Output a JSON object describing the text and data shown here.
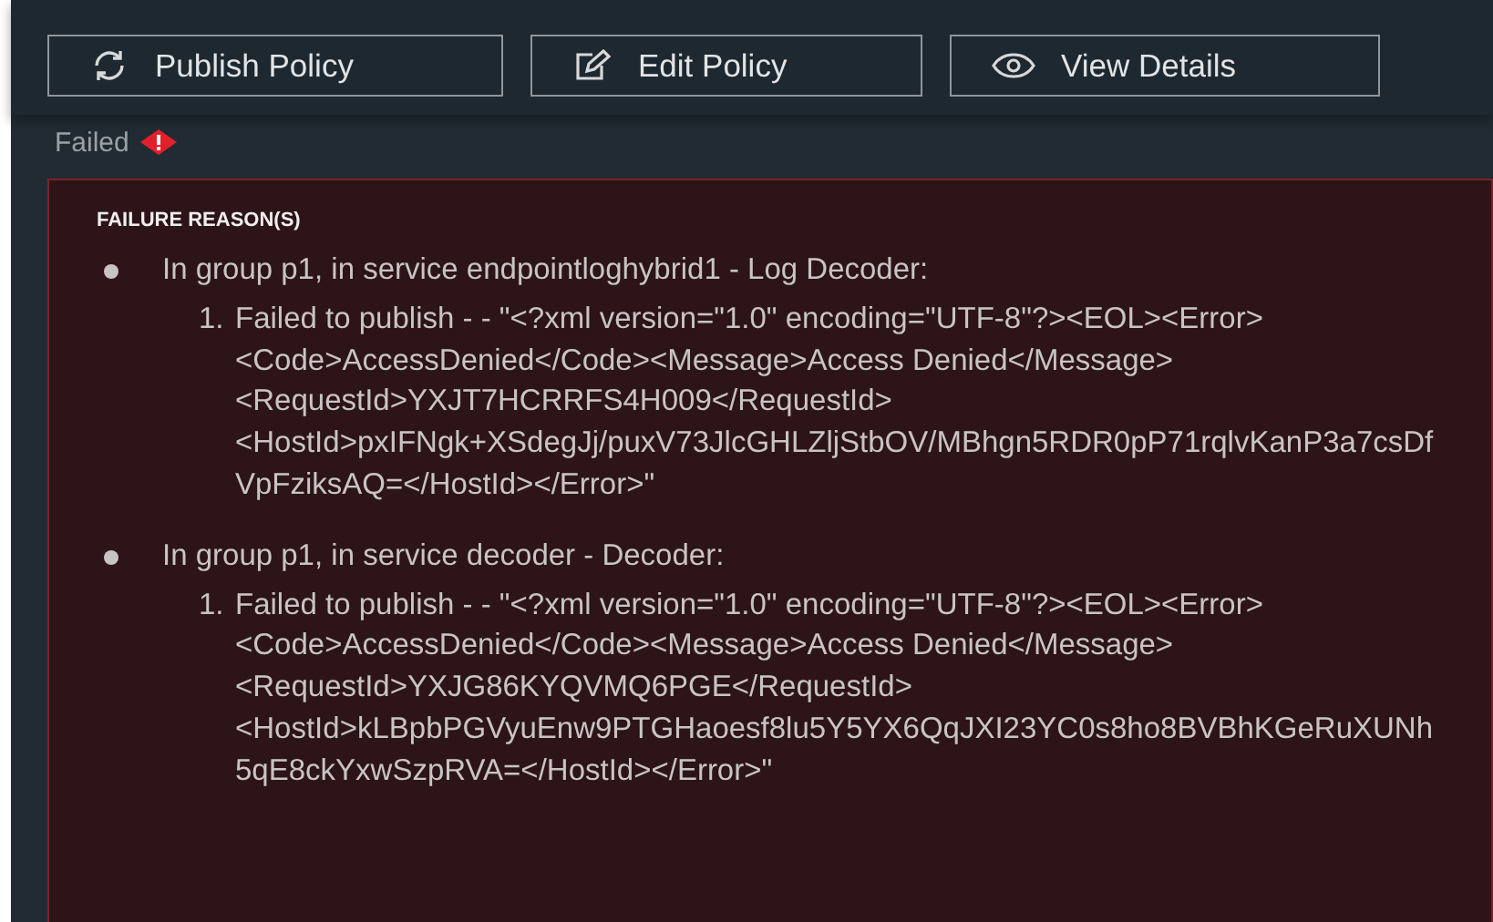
{
  "toolbar": {
    "buttons": [
      {
        "label": "Publish Policy",
        "kind": "publish"
      },
      {
        "label": "Edit Policy",
        "kind": "edit"
      },
      {
        "label": "View Details",
        "kind": "view"
      }
    ]
  },
  "status": {
    "label": "Failed",
    "kind": "error"
  },
  "failure_panel": {
    "title": "FAILURE REASON(S)",
    "groups": [
      {
        "heading": "In group p1, in service endpointloghybrid1 - Log Decoder:",
        "messages": [
          {
            "number": "1.",
            "text": "Failed to publish - - \"<?xml version=\"1.0\" encoding=\"UTF-8\"?><EOL><Error><Code>AccessDenied</Code><Message>Access Denied</Message><RequestId>YXJT7HCRRFS4H009</RequestId><HostId>pxIFNgk+XSdegJj/puxV73JlcGHLZljStbOV/MBhgn5RDR0pP71rqlvKanP3a7csDfVpFziksAQ=</HostId></Error>\""
          }
        ]
      },
      {
        "heading": "In group p1, in service decoder - Decoder:",
        "messages": [
          {
            "number": "1.",
            "text": "Failed to publish - - \"<?xml version=\"1.0\" encoding=\"UTF-8\"?><EOL><Error><Code>AccessDenied</Code><Message>Access Denied</Message><RequestId>YXJG86KYQVMQ6PGE</RequestId><HostId>kLBpbPGVyuEnw9PTGHaoesf8lu5Y5YX6QqJXI23YC0s8ho8BVBhKGeRuXUNh5qE8ckYxwSzpRVA=</HostId></Error>\""
          }
        ]
      }
    ]
  }
}
